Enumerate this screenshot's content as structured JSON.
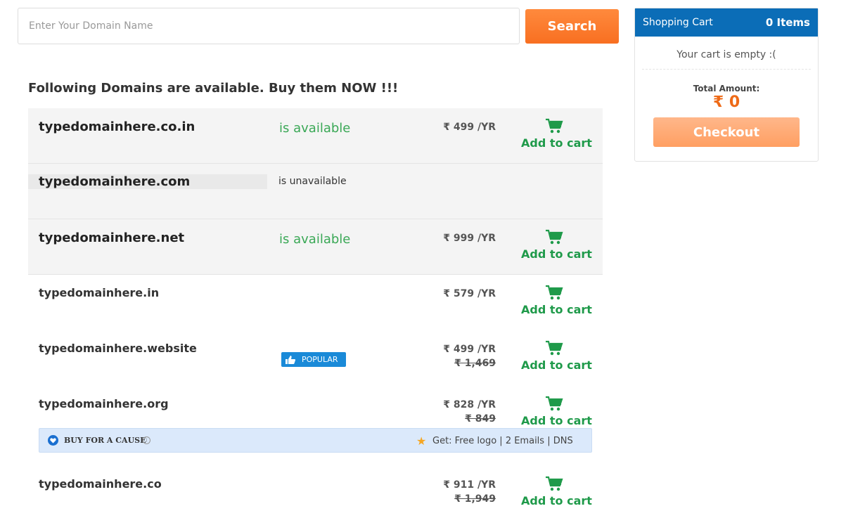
{
  "search": {
    "placeholder": "Enter Your Domain Name",
    "button_label": "Search"
  },
  "results": {
    "heading": "Following Domains are available. Buy them NOW !!!",
    "rows": [
      {
        "domain": "typedomainhere.co.in",
        "status": "is available",
        "price": "₹ 499 /YR",
        "add_label": "Add to cart"
      },
      {
        "domain": "typedomainhere.com",
        "status": "is unavailable"
      },
      {
        "domain": "typedomainhere.net",
        "status": "is available",
        "price": "₹ 999 /YR",
        "add_label": "Add to cart"
      },
      {
        "domain": "typedomainhere.in",
        "price": "₹ 579 /YR",
        "add_label": "Add to cart"
      },
      {
        "domain": "typedomainhere.website",
        "badge": "POPULAR",
        "price": "₹ 499 /YR",
        "old_price": "₹ 1,469",
        "add_label": "Add to cart"
      },
      {
        "domain": "typedomainhere.org",
        "price": "₹ 828 /YR",
        "old_price": "₹ 849",
        "add_label": "Add to cart"
      },
      {
        "domain": "typedomainhere.co",
        "price": "₹ 911 /YR",
        "old_price": "₹ 1,949",
        "add_label": "Add to cart"
      }
    ],
    "cause_banner": {
      "label": "BUY FOR A CAUSE",
      "perks": "Get: Free logo | 2 Emails | DNS"
    }
  },
  "cart": {
    "title": "Shopping Cart",
    "count": "0 Items",
    "empty_text": "Your cart is empty :(",
    "total_label": "Total Amount:",
    "total_value": "₹ 0",
    "checkout_label": "Checkout"
  },
  "colors": {
    "accent_orange": "#f86f21",
    "cart_header": "#0b6db7",
    "available_green": "#3aa856",
    "add_green": "#1f9a4a",
    "popular_blue": "#1a8ad8"
  },
  "icons": [
    "cart-icon",
    "thumbs-up-icon",
    "heart-icon",
    "info-icon",
    "star-icon"
  ]
}
